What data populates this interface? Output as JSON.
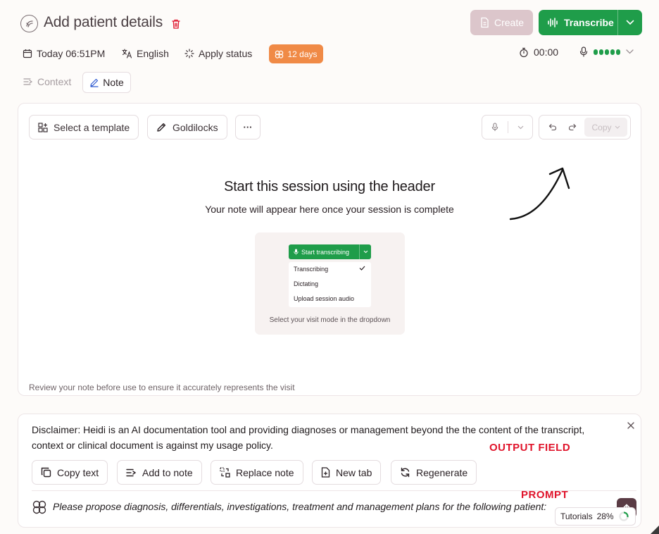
{
  "header": {
    "title": "Add patient details",
    "create_label": "Create",
    "transcribe_label": "Transcribe"
  },
  "meta": {
    "datetime": "Today 06:51PM",
    "language": "English",
    "status": "Apply status",
    "days_badge": "12 days",
    "timer": "00:00"
  },
  "tabs": [
    {
      "label": "Context"
    },
    {
      "label": "Note"
    }
  ],
  "note_panel": {
    "template_label": "Select a template",
    "style_label": "Goldilocks",
    "more_label": "···",
    "copy_label": "Copy",
    "empty_title": "Start this session using the header",
    "empty_subtitle": "Your note will appear here once your session is complete",
    "illustration": {
      "button_label": "Start transcribing",
      "options": [
        "Transcribing",
        "Dictating",
        "Upload session audio"
      ],
      "caption": "Select your visit mode in the dropdown"
    },
    "review_notice": "Review your note before use to ensure it accurately represents the visit"
  },
  "output_panel": {
    "disclaimer": "Disclaimer: Heidi is an AI documentation tool and providing diagnoses or management beyond the the content of the transcript, context or clinical document is against my usage policy.",
    "annotation_output": "OUTPUT FIELD",
    "annotation_prompt": "PROMPT",
    "actions": [
      "Copy text",
      "Add to note",
      "Replace note",
      "New tab",
      "Regenerate"
    ],
    "prompt_text": "Please propose diagnosis, differentials, investigations, treatment and management plans for the following patient:"
  },
  "tutorials": {
    "label": "Tutorials",
    "percent": "28%",
    "progress": 0.28
  },
  "colors": {
    "accent_green": "#1f9d4a",
    "badge_orange": "#f08a46",
    "annotation_red": "#e0142b",
    "create_disabled": "#dcc6cb"
  }
}
